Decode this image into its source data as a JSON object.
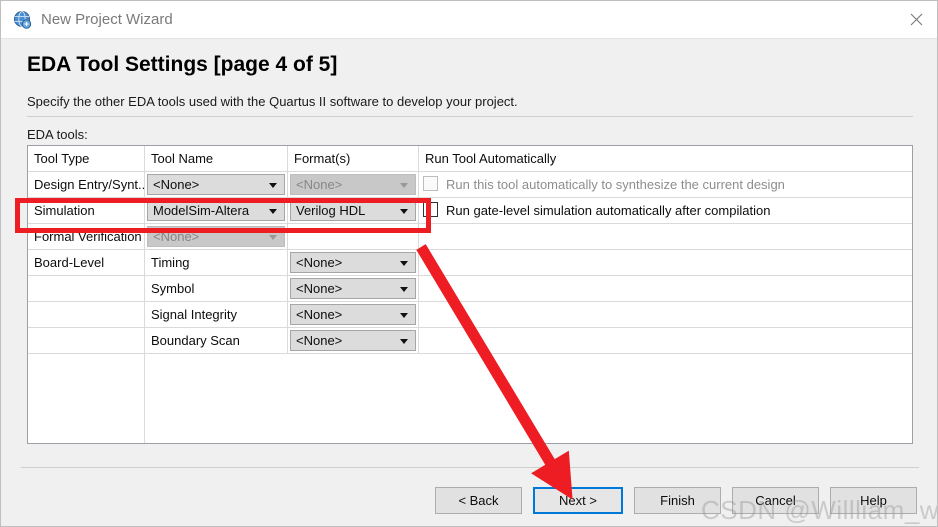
{
  "window": {
    "title": "New Project Wizard",
    "icon": "quartus-globe-icon",
    "close_label": "✕"
  },
  "page": {
    "heading": "EDA Tool Settings [page 4 of 5]",
    "subtext": "Specify the other EDA tools used with the Quartus II software to develop your project.",
    "section_label": "EDA tools:"
  },
  "table": {
    "headers": [
      "Tool Type",
      "Tool Name",
      "Format(s)",
      "Run Tool Automatically"
    ],
    "rows": [
      {
        "tool_type": "Design Entry/Synt...",
        "tool_name": "<None>",
        "tool_name_disabled": false,
        "format": "<None>",
        "format_disabled": true,
        "checkbox": true,
        "checkbox_disabled": true,
        "run_label": "Run this tool automatically to synthesize the current design"
      },
      {
        "tool_type": "Simulation",
        "tool_name": "ModelSim-Altera",
        "tool_name_disabled": false,
        "format": "Verilog HDL",
        "format_disabled": false,
        "checkbox": true,
        "checkbox_disabled": false,
        "run_label": "Run gate-level simulation automatically after compilation"
      },
      {
        "tool_type": "Formal Verification",
        "tool_name": "<None>",
        "tool_name_disabled": true,
        "format": null,
        "format_disabled": false,
        "checkbox": false,
        "checkbox_disabled": false,
        "run_label": ""
      },
      {
        "tool_type": "Board-Level",
        "tool_name": "Timing",
        "tool_name_plain": true,
        "format": "<None>",
        "format_disabled": false,
        "checkbox": false,
        "run_label": ""
      },
      {
        "tool_type": "",
        "tool_name": "Symbol",
        "tool_name_plain": true,
        "format": "<None>",
        "format_disabled": false,
        "checkbox": false,
        "run_label": ""
      },
      {
        "tool_type": "",
        "tool_name": "Signal Integrity",
        "tool_name_plain": true,
        "format": "<None>",
        "format_disabled": false,
        "checkbox": false,
        "run_label": ""
      },
      {
        "tool_type": "",
        "tool_name": "Boundary Scan",
        "tool_name_plain": true,
        "format": "<None>",
        "format_disabled": false,
        "checkbox": false,
        "run_label": ""
      }
    ]
  },
  "footer": {
    "buttons": [
      {
        "label": "< Back",
        "focused": false
      },
      {
        "label": "Next >",
        "focused": true
      },
      {
        "label": "Finish",
        "focused": false
      },
      {
        "label": "Cancel",
        "focused": false
      },
      {
        "label": "Help",
        "focused": false
      }
    ]
  },
  "annotations": {
    "highlight_color": "#ee1d24",
    "arrow_color": "#ee1d24",
    "watermark": "CSDN @Willliam_william"
  }
}
